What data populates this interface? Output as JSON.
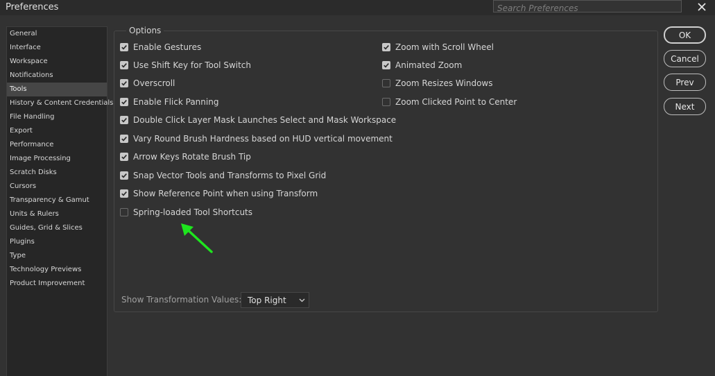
{
  "window": {
    "title": "Preferences"
  },
  "search": {
    "placeholder": "Search Preferences"
  },
  "sidebar": {
    "items": [
      {
        "label": "General"
      },
      {
        "label": "Interface"
      },
      {
        "label": "Workspace"
      },
      {
        "label": "Notifications"
      },
      {
        "label": "Tools",
        "active": true
      },
      {
        "label": "History & Content Credentials"
      },
      {
        "label": "File Handling"
      },
      {
        "label": "Export"
      },
      {
        "label": "Performance"
      },
      {
        "label": "Image Processing"
      },
      {
        "label": "Scratch Disks"
      },
      {
        "label": "Cursors"
      },
      {
        "label": "Transparency & Gamut"
      },
      {
        "label": "Units & Rulers"
      },
      {
        "label": "Guides, Grid & Slices"
      },
      {
        "label": "Plugins"
      },
      {
        "label": "Type"
      },
      {
        "label": "Technology Previews"
      },
      {
        "label": "Product Improvement"
      }
    ]
  },
  "options": {
    "legend": "Options",
    "left": [
      {
        "label": "Enable Gestures",
        "checked": true
      },
      {
        "label": "Use Shift Key for Tool Switch",
        "checked": true
      },
      {
        "label": "Overscroll",
        "checked": true
      },
      {
        "label": "Enable Flick Panning",
        "checked": true
      },
      {
        "label": "Double Click Layer Mask Launches Select and Mask Workspace",
        "checked": true
      },
      {
        "label": "Vary Round Brush Hardness based on HUD vertical movement",
        "checked": true
      },
      {
        "label": "Arrow Keys Rotate Brush Tip",
        "checked": true
      },
      {
        "label": "Snap Vector Tools and Transforms to Pixel Grid",
        "checked": true
      },
      {
        "label": "Show Reference Point when using Transform",
        "checked": true
      },
      {
        "label": "Spring-loaded Tool Shortcuts",
        "checked": false
      }
    ],
    "right": [
      {
        "label": "Zoom with Scroll Wheel",
        "checked": true
      },
      {
        "label": "Animated Zoom",
        "checked": true
      },
      {
        "label": "Zoom Resizes Windows",
        "checked": false
      },
      {
        "label": "Zoom Clicked Point to Center",
        "checked": false
      }
    ],
    "transformation": {
      "label": "Show Transformation Values:",
      "value": "Top Right"
    }
  },
  "buttons": {
    "ok": "OK",
    "cancel": "Cancel",
    "prev": "Prev",
    "next": "Next"
  },
  "colors": {
    "background": "#323232",
    "annotation_arrow": "#1ee51e",
    "checkbox_on": "#c8c8c8"
  }
}
